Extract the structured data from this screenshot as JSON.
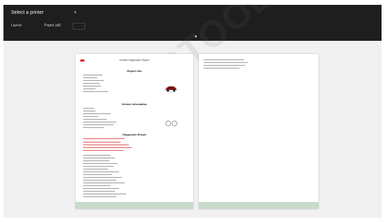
{
  "header": {
    "title": "Select a printer",
    "buttons": [
      "Layout",
      "Pages (all)"
    ]
  },
  "page1": {
    "title": "Vehicle Diagnostic Report",
    "subtitle": "",
    "sections": [
      "Report Info",
      "Vehicle Information",
      "Diagnostic Result"
    ]
  },
  "watermark": "DIAGTOOL",
  "colors": {
    "toolbar": "#1e1e1e",
    "background": "#f1f1f1",
    "accent_red": "#d62020",
    "footer_green": "#c8dccc"
  },
  "icons": [
    "collapse-chevron-icon",
    "brand-logo-icon",
    "car-icon",
    "obd-connector-icon"
  ]
}
